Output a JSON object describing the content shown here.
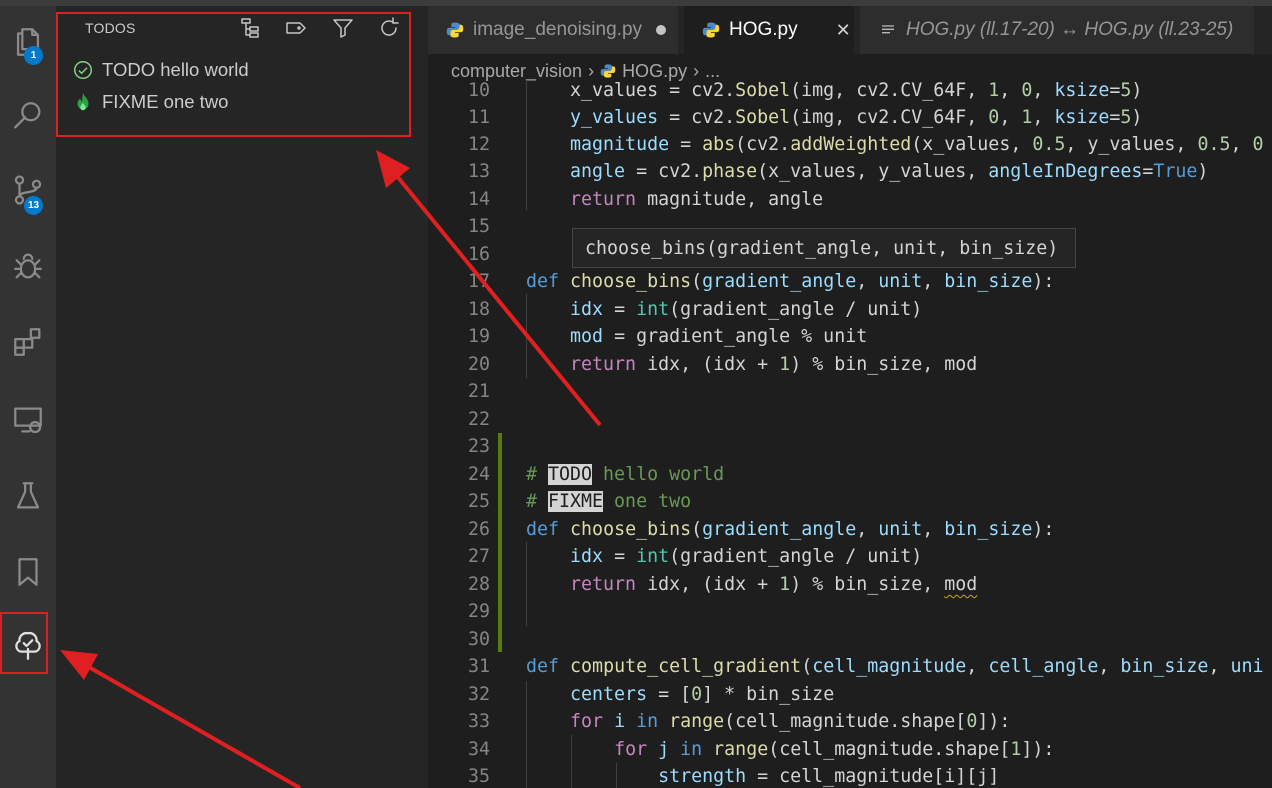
{
  "activity_bar": {
    "explorer_badge": "1",
    "scm_badge": "13",
    "items": [
      "explorer",
      "search",
      "source-control",
      "run-debug",
      "extensions",
      "remote-explorer",
      "testing",
      "bookmarks",
      "todo-tree"
    ]
  },
  "sidebar": {
    "title": "TODOS",
    "items": [
      {
        "label": "TODO hello world",
        "icon": "check-circle-icon"
      },
      {
        "label": "FIXME one two",
        "icon": "flame-icon"
      }
    ]
  },
  "tabs": [
    {
      "label": "image_denoising.py",
      "dirty": true
    },
    {
      "label": "HOG.py",
      "active": true,
      "close": "✕"
    },
    {
      "label": "HOG.py (ll.17-20) ↔ HOG.py (ll.23-25)"
    }
  ],
  "breadcrumb": {
    "folder": "computer_vision",
    "file": "HOG.py",
    "rest": "..."
  },
  "hover": {
    "signature": "choose_bins(gradient_angle, unit, bin_size)"
  },
  "code": {
    "line_numbers": [
      "10",
      "11",
      "12",
      "13",
      "14",
      "15",
      "16",
      "17",
      "18",
      "19",
      "20",
      "21",
      "22",
      "23",
      "24",
      "25",
      "26",
      "27",
      "28",
      "29",
      "30",
      "31",
      "32",
      "33",
      "34",
      "35"
    ]
  },
  "colors": {
    "annotation_red": "#e02020",
    "accent_blue": "#007acc",
    "fixme_flame": "#2ea043"
  }
}
